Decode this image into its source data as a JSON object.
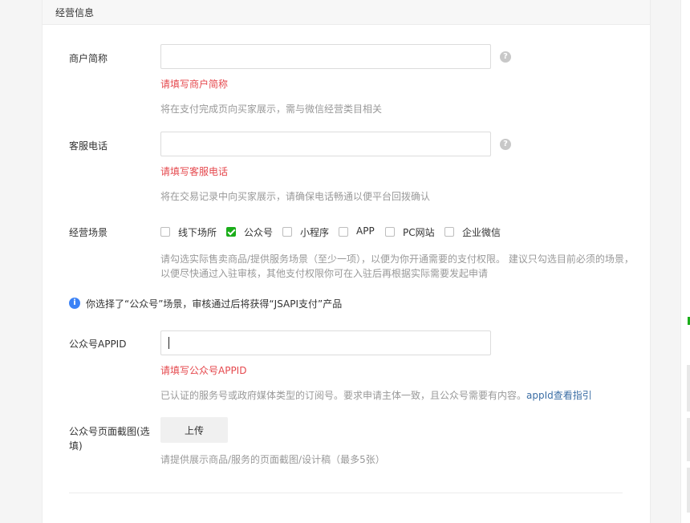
{
  "section": {
    "title": "经营信息"
  },
  "merchant_name": {
    "label": "商户简称",
    "value": "",
    "error": "请填写商户简称",
    "hint": "将在支付完成页向买家展示，需与微信经营类目相关",
    "help_icon": "question-circle-icon"
  },
  "service_phone": {
    "label": "客服电话",
    "value": "",
    "error": "请填写客服电话",
    "hint": "将在交易记录中向买家展示，请确保电话畅通以便平台回拨确认",
    "help_icon": "question-circle-icon"
  },
  "scenes": {
    "label": "经营场景",
    "options": [
      {
        "label": "线下场所",
        "checked": false
      },
      {
        "label": "公众号",
        "checked": true
      },
      {
        "label": "小程序",
        "checked": false
      },
      {
        "label": "APP",
        "checked": false
      },
      {
        "label": "PC网站",
        "checked": false
      },
      {
        "label": "企业微信",
        "checked": false
      }
    ],
    "hint_line1": "请勾选实际售卖商品/提供服务场景（至少一项），以便为你开通需要的支付权限。 建议只勾选目前必须的场景，",
    "hint_line2": "以便尽快通过入驻审核，其他支付权限你可在入驻后再根据实际需要发起申请"
  },
  "notice": {
    "icon": "info-circle-icon",
    "text": "你选择了“公众号”场景，审核通过后将获得“JSAPI支付”产品"
  },
  "appid": {
    "label": "公众号APPID",
    "value": "",
    "error": "请填写公众号APPID",
    "hint": "已认证的服务号或政府媒体类型的订阅号。要求申请主体一致，且公众号需要有内容。",
    "link": "appId查看指引"
  },
  "screenshot": {
    "label_line1": "公众号页面截图(选",
    "label_line2": "填)",
    "upload_label": "上传",
    "hint": "请提供展示商品/服务的页面截图/设计稿（最多5张）"
  },
  "colors": {
    "error": "#e5484d",
    "checked": "#1aad19",
    "info": "#3b82f6",
    "link": "#3b6ea5",
    "hint": "#999999"
  }
}
